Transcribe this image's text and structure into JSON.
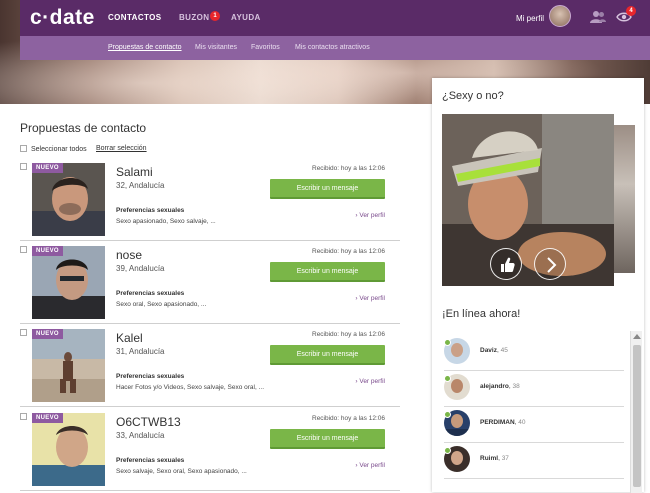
{
  "brand": {
    "logo": "c·date"
  },
  "nav": {
    "items": [
      {
        "label": "CONTACTOS",
        "active": true
      },
      {
        "label": "BUZON",
        "badge": "1"
      },
      {
        "label": "AYUDA"
      }
    ],
    "profile_label": "Mi perfil",
    "eye_badge": "4",
    "icons": [
      "contacts-icon",
      "eye-icon"
    ]
  },
  "subnav": {
    "items": [
      {
        "label": "Propuestas de contacto",
        "active": true
      },
      {
        "label": "Mis visitantes"
      },
      {
        "label": "Favoritos"
      },
      {
        "label": "Mis contactos atractivos"
      }
    ]
  },
  "main": {
    "title": "Propuestas de contacto",
    "select_all": "Seleccionar todos",
    "clear_selection": "Borrar selección",
    "cards": [
      {
        "new": "NUEVO",
        "name": "Salami",
        "meta": "32, Andalucía",
        "received": "Recibido: hoy a las 12:06",
        "button": "Escribir un mensaje",
        "pref_title": "Preferencias sexuales",
        "pref_values": "Sexo apasionado, Sexo salvaje, ...",
        "view": "› Ver perfil"
      },
      {
        "new": "NUEVO",
        "name": "nose",
        "meta": "39, Andalucía",
        "received": "Recibido: hoy a las 12:06",
        "button": "Escribir un mensaje",
        "pref_title": "Preferencias sexuales",
        "pref_values": "Sexo oral, Sexo apasionado, ...",
        "view": "› Ver perfil"
      },
      {
        "new": "NUEVO",
        "name": "Kalel",
        "meta": "31, Andalucía",
        "received": "Recibido: hoy a las 12:06",
        "button": "Escribir un mensaje",
        "pref_title": "Preferencias sexuales",
        "pref_values": "Hacer Fotos y/o Videos, Sexo salvaje, Sexo oral, ...",
        "view": "› Ver perfil"
      },
      {
        "new": "NUEVO",
        "name": "O6CTWB13",
        "meta": "33, Andalucía",
        "received": "Recibido: hoy a las 12:06",
        "button": "Escribir un mensaje",
        "pref_title": "Preferencias sexuales",
        "pref_values": "Sexo salvaje, Sexo oral, Sexo apasionado, ...",
        "view": "› Ver perfil"
      }
    ]
  },
  "sidebar": {
    "sexy_title": "¿Sexy o no?",
    "online_title": "¡En línea ahora!",
    "online": [
      {
        "name": "Daviz",
        "age": "45"
      },
      {
        "name": "alejandro",
        "age": "38"
      },
      {
        "name": "PERDIMAN",
        "age": "40"
      },
      {
        "name": "Ruiml",
        "age": "37"
      }
    ]
  },
  "colors": {
    "nav": "#5a2b67",
    "subnav": "#8d62a0",
    "button": "#7ab648",
    "badge": "#8e5aa0",
    "notify": "#e8262c"
  }
}
